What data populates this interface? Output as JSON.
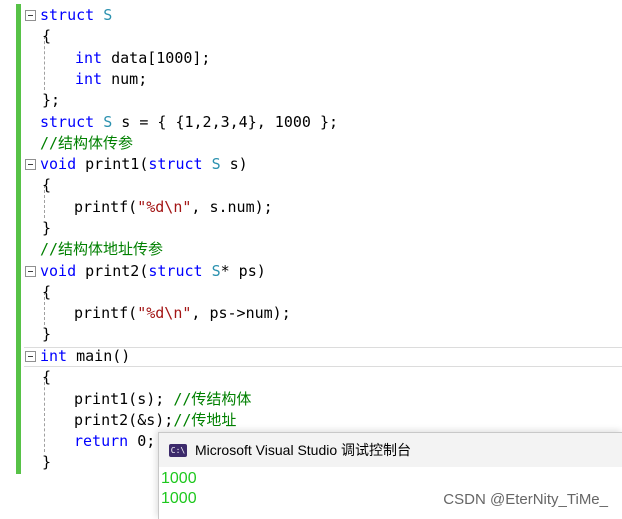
{
  "editor": {
    "lines": {
      "l1a": "struct",
      "l1b": " S",
      "l2": "{",
      "l3a": "int",
      "l3b": " data[1000];",
      "l4a": "int",
      "l4b": " num;",
      "l5": "};",
      "l6a": "struct",
      "l6b": " S",
      "l6c": " s = { {1,2,3,4}, 1000 };",
      "l7": "//结构体传参",
      "l8a": "void",
      "l8b": " print1(",
      "l8c": "struct",
      "l8d": " S",
      "l8e": " s)",
      "l9": "{",
      "l10a": "printf(",
      "l10b": "\"%d\\n\"",
      "l10c": ", s.num);",
      "l11": "}",
      "l12": "//结构体地址传参",
      "l13a": "void",
      "l13b": " print2(",
      "l13c": "struct",
      "l13d": " S",
      "l13e": "* ps)",
      "l14": "{",
      "l15a": "printf(",
      "l15b": "\"%d\\n\"",
      "l15c": ", ps->num);",
      "l16": "}",
      "l17a": "int",
      "l17b": " main()",
      "l18": "{",
      "l19a": "print1(s); ",
      "l19b": "//传结构体",
      "l20a": "print2(&s);",
      "l20b": "//传地址",
      "l21a": "return",
      "l21b": " 0;",
      "l22": "}"
    }
  },
  "console": {
    "icon_text": "C:\\",
    "title": "Microsoft Visual Studio 调试控制台",
    "output": [
      "1000",
      "1000"
    ]
  },
  "watermark": "CSDN @EterNity_TiMe_",
  "colors": {
    "keyword": "#0000ff",
    "type": "#2b91af",
    "comment": "#008000",
    "string": "#a31515",
    "console_output": "#1ec81e",
    "gutter": "#57c247"
  }
}
